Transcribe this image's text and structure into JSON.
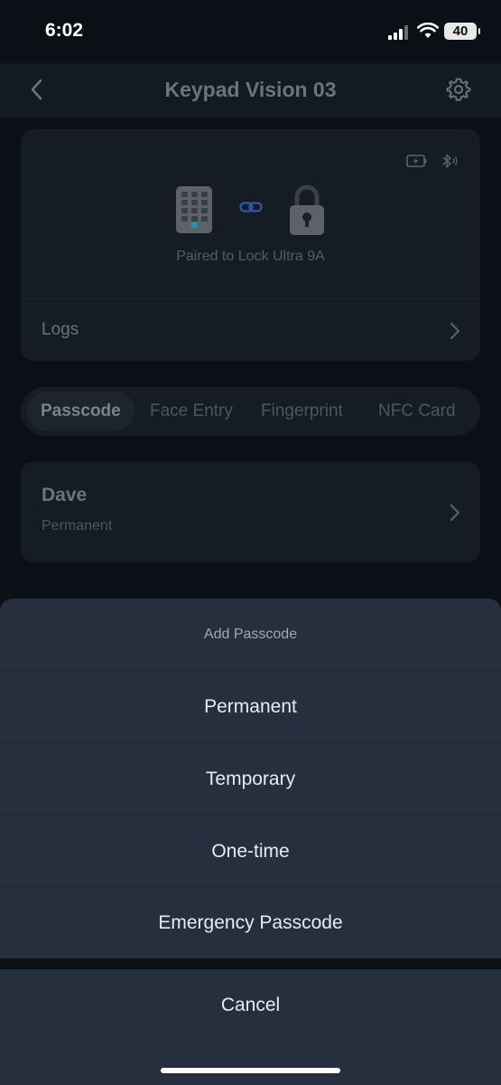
{
  "status_bar": {
    "time": "6:02",
    "battery": "40"
  },
  "nav": {
    "title": "Keypad Vision 03",
    "back_icon": "chevron-left-icon",
    "settings_icon": "gear-icon"
  },
  "device_card": {
    "pair_text": "Paired to Lock Ultra 9A",
    "logs_label": "Logs"
  },
  "tabs": [
    {
      "label": "Passcode",
      "active": true
    },
    {
      "label": "Face Entry",
      "active": false
    },
    {
      "label": "Fingerprint",
      "active": false
    },
    {
      "label": "NFC Card",
      "active": false
    }
  ],
  "user": {
    "name": "Dave",
    "type": "Permanent"
  },
  "action_sheet": {
    "title": "Add Passcode",
    "options": [
      "Permanent",
      "Temporary",
      "One-time",
      "Emergency Passcode"
    ],
    "cancel": "Cancel"
  },
  "colors": {
    "background": "#0b1016",
    "card": "#161c24",
    "sheet": "#252f3e",
    "accent": "#2a8fb3"
  }
}
